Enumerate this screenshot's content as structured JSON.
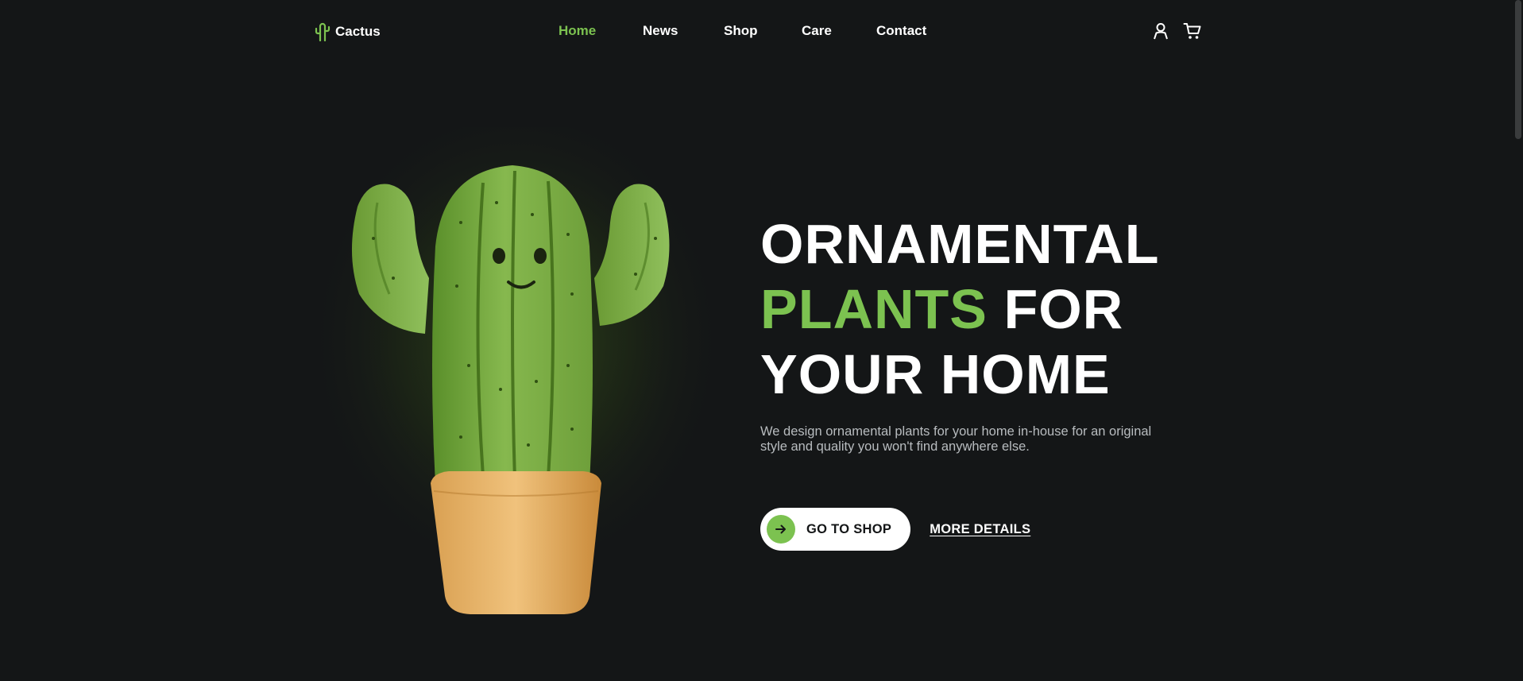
{
  "brand": {
    "name": "Cactus",
    "icon": "cactus-logo-icon",
    "accent_color": "#7cc250",
    "background_color": "#141617"
  },
  "nav": {
    "items": [
      {
        "label": "Home",
        "active": true
      },
      {
        "label": "News",
        "active": false
      },
      {
        "label": "Shop",
        "active": false
      },
      {
        "label": "Care",
        "active": false
      },
      {
        "label": "Contact",
        "active": false
      }
    ]
  },
  "header_icons": {
    "account": "user-icon",
    "cart": "cart-icon"
  },
  "hero": {
    "title_line1": "ORNAMENTAL",
    "title_line2_accent": "PLANTS",
    "title_line2_rest": " FOR",
    "title_line3": "YOUR HOME",
    "description": "We design ornamental plants for your home in-house for an original style and quality you won't find anywhere else.",
    "primary_cta": "GO TO SHOP",
    "primary_cta_icon": "arrow-right-icon",
    "secondary_cta": "MORE DETAILS"
  }
}
